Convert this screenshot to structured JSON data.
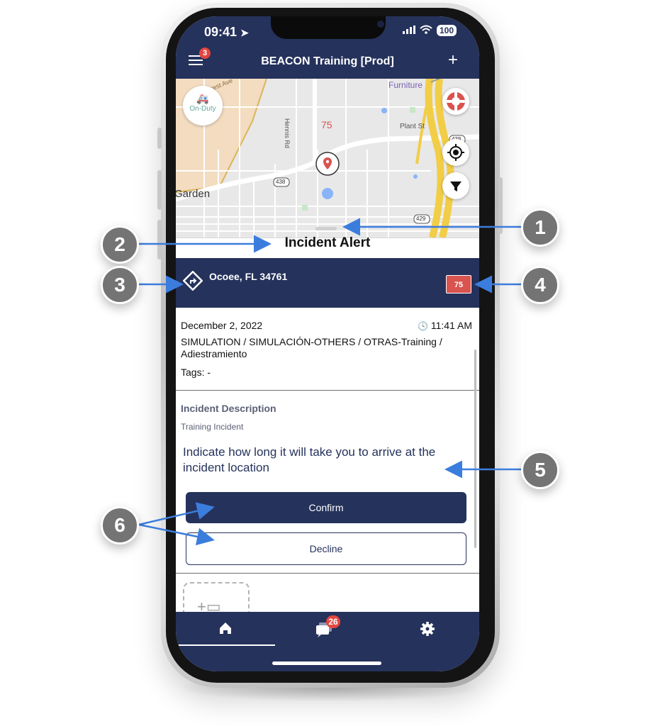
{
  "status_bar": {
    "time": "09:41",
    "battery": "100"
  },
  "header": {
    "title": "BEACON Training [Prod]",
    "menu_badge": "3",
    "add_label": "+"
  },
  "map": {
    "onduty_label": "On-Duty",
    "labels": {
      "crest": "E Crest Ave",
      "hennis": "Hennis Rd",
      "plant": "Plant St",
      "garden": "Garden",
      "furniture": "Furniture",
      "priority": "75",
      "route_438_a": "438",
      "route_438_b": "438",
      "route_429": "429"
    }
  },
  "sheet": {
    "title": "Incident Alert"
  },
  "incident": {
    "address": "Ocoee, FL 34761",
    "priority_badge": "75",
    "date": "December 2, 2022",
    "time": "11:41 AM",
    "category": "SIMULATION / SIMULACIÓN-OTHERS / OTRAS-Training / Adiestramiento",
    "tags": "Tags: -",
    "description_title": "Incident Description",
    "description_text": "Training Incident",
    "prompt": "Indicate how long it will take you to arrive at the incident location"
  },
  "actions": {
    "confirm": "Confirm",
    "decline": "Decline"
  },
  "tabbar": {
    "messages_badge": "26"
  },
  "callouts": [
    "1",
    "2",
    "3",
    "4",
    "5",
    "6"
  ],
  "colors": {
    "navy": "#25325c",
    "red": "#e2463f",
    "callout_grey": "#747474",
    "arrow_blue": "#3b7ddd"
  }
}
